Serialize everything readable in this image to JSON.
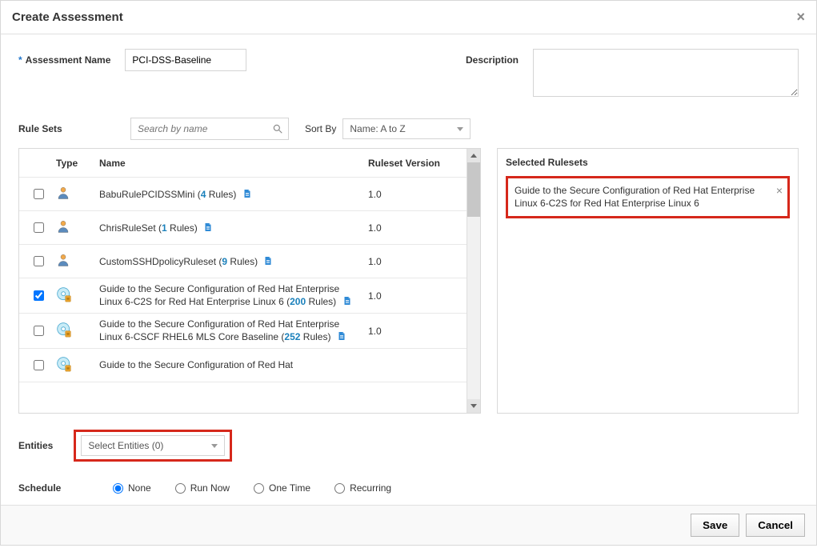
{
  "dialog": {
    "title": "Create Assessment"
  },
  "fields": {
    "name_label": "Assessment Name",
    "name_value": "PCI-DSS-Baseline",
    "desc_label": "Description"
  },
  "rulesets": {
    "heading": "Rule Sets",
    "search_placeholder": "Search by name",
    "sort_label": "Sort By",
    "sort_value": "Name: A to Z",
    "cols": {
      "type": "Type",
      "name": "Name",
      "ver": "Ruleset Version"
    },
    "rows": [
      {
        "checked": false,
        "icon": "person",
        "name_pre": "BabuRulePCIDSSMini (",
        "count": "4",
        "name_post": " Rules) ",
        "ver": "1.0",
        "multiline": false
      },
      {
        "checked": false,
        "icon": "person",
        "name_pre": "ChrisRuleSet (",
        "count": "1",
        "name_post": " Rules) ",
        "ver": "1.0",
        "multiline": false
      },
      {
        "checked": false,
        "icon": "person",
        "name_pre": "CustomSSHDpolicyRuleset (",
        "count": "9",
        "name_post": " Rules) ",
        "ver": "1.0",
        "multiline": false
      },
      {
        "checked": true,
        "icon": "disc",
        "name_pre": "Guide to the Secure Configuration of Red Hat Enterprise Linux 6-C2S for Red Hat Enterprise Linux 6 (",
        "count": "200",
        "name_post": " Rules) ",
        "ver": "1.0",
        "multiline": true
      },
      {
        "checked": false,
        "icon": "disc",
        "name_pre": "Guide to the Secure Configuration of Red Hat Enterprise Linux 6-CSCF RHEL6 MLS Core Baseline (",
        "count": "252",
        "name_post": " Rules) ",
        "ver": "1.0",
        "multiline": true
      },
      {
        "checked": false,
        "icon": "disc",
        "name_pre": "Guide to the Secure Configuration of Red Hat",
        "count": "",
        "name_post": "",
        "ver": "",
        "multiline": true
      }
    ]
  },
  "selected": {
    "heading": "Selected Rulesets",
    "items": [
      "Guide to the Secure Configuration of Red Hat Enterprise Linux 6-C2S for Red Hat Enterprise Linux 6"
    ]
  },
  "entities": {
    "label": "Entities",
    "value": "Select Entities (0)"
  },
  "schedule": {
    "label": "Schedule",
    "options": [
      "None",
      "Run Now",
      "One Time",
      "Recurring"
    ],
    "selected": 0
  },
  "footer": {
    "save": "Save",
    "cancel": "Cancel"
  }
}
